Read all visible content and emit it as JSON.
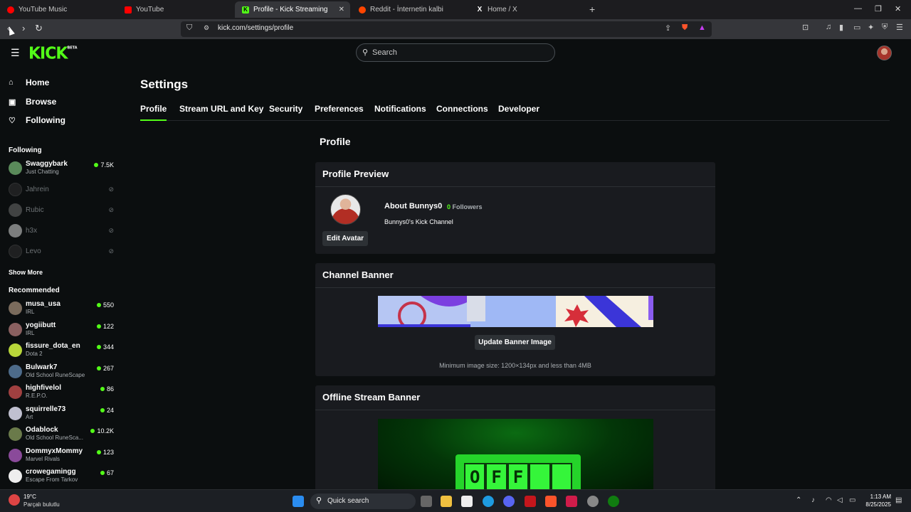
{
  "browser": {
    "tabs": [
      {
        "title": "YouTube Music",
        "color": "#ff0000"
      },
      {
        "title": "YouTube",
        "color": "#ff0000"
      },
      {
        "title": "Profile - Kick Streaming",
        "color": "#53fc18",
        "active": true
      },
      {
        "title": "Reddit - İnternetin kalbi",
        "color": "#ff4500"
      },
      {
        "title": "Home / X",
        "color": "#000000"
      }
    ],
    "url": "kick.com/settings/profile"
  },
  "header": {
    "logo_text": "KICK",
    "logo_badge": "BETA",
    "search_placeholder": "Search"
  },
  "sidebar": {
    "nav": [
      {
        "label": "Home",
        "icon": "home-icon"
      },
      {
        "label": "Browse",
        "icon": "browse-icon"
      },
      {
        "label": "Following",
        "icon": "heart-icon"
      }
    ],
    "following_title": "Following",
    "following": [
      {
        "name": "Swaggybark",
        "category": "Just Chatting",
        "viewers": "7.5K",
        "live": true,
        "color": "#5a8a5a"
      },
      {
        "name": "Jahrein",
        "live": false,
        "color": "#333"
      },
      {
        "name": "Rubic",
        "live": false,
        "color": "#555"
      },
      {
        "name": "h3x",
        "live": false,
        "color": "#eee"
      },
      {
        "name": "Levo",
        "live": false,
        "color": "#333"
      }
    ],
    "show_more": "Show More",
    "recommended_title": "Recommended",
    "recommended": [
      {
        "name": "musa_usa",
        "category": "IRL",
        "viewers": "550",
        "color": "#7a6b5c"
      },
      {
        "name": "yogiibutt",
        "category": "IRL",
        "viewers": "122",
        "color": "#8a6060"
      },
      {
        "name": "fissure_dota_en",
        "category": "Dota 2",
        "viewers": "344",
        "color": "#b8d63a"
      },
      {
        "name": "Bulwark7",
        "category": "Old School RuneScape",
        "viewers": "267",
        "color": "#4d6b8a"
      },
      {
        "name": "highfivelol",
        "category": "R.E.P.O.",
        "viewers": "86",
        "color": "#a04040"
      },
      {
        "name": "squirrelle73",
        "category": "Art",
        "viewers": "24",
        "color": "#c0c0d0"
      },
      {
        "name": "Odablock",
        "category": "Old School RuneSca...",
        "viewers": "10.2K",
        "color": "#6a7a4a"
      },
      {
        "name": "DommyxMommy",
        "category": "Marvel Rivals",
        "viewers": "123",
        "color": "#8a4a9a"
      },
      {
        "name": "crowegamingg",
        "category": "Escape From Tarkov",
        "viewers": "67",
        "color": "#eeeeee"
      }
    ]
  },
  "settings": {
    "title": "Settings",
    "tabs": [
      "Profile",
      "Stream URL and Key",
      "Security",
      "Preferences",
      "Notifications",
      "Connections",
      "Developer"
    ],
    "section_title": "Profile",
    "profile_preview": {
      "title": "Profile Preview",
      "about": "About Bunnys0",
      "followers_count": "0",
      "followers_label": "Followers",
      "description": "Bunnys0's Kick Channel",
      "edit_avatar": "Edit Avatar"
    },
    "channel_banner": {
      "title": "Channel Banner",
      "update_button": "Update Banner Image",
      "hint": "Minimum image size: 1200×134px and less than 4MB"
    },
    "offline_banner": {
      "title": "Offline Stream Banner",
      "sign_text": [
        "O",
        "F",
        "F",
        "",
        ""
      ]
    }
  },
  "taskbar": {
    "temperature": "19°C",
    "weather": "Parçalı bulutlu",
    "search_label": "Quick search",
    "time": "1:13 AM",
    "date": "8/25/2025"
  },
  "colors": {
    "accent": "#53fc18",
    "background": "#0b0e0f",
    "card": "#191b1f"
  }
}
